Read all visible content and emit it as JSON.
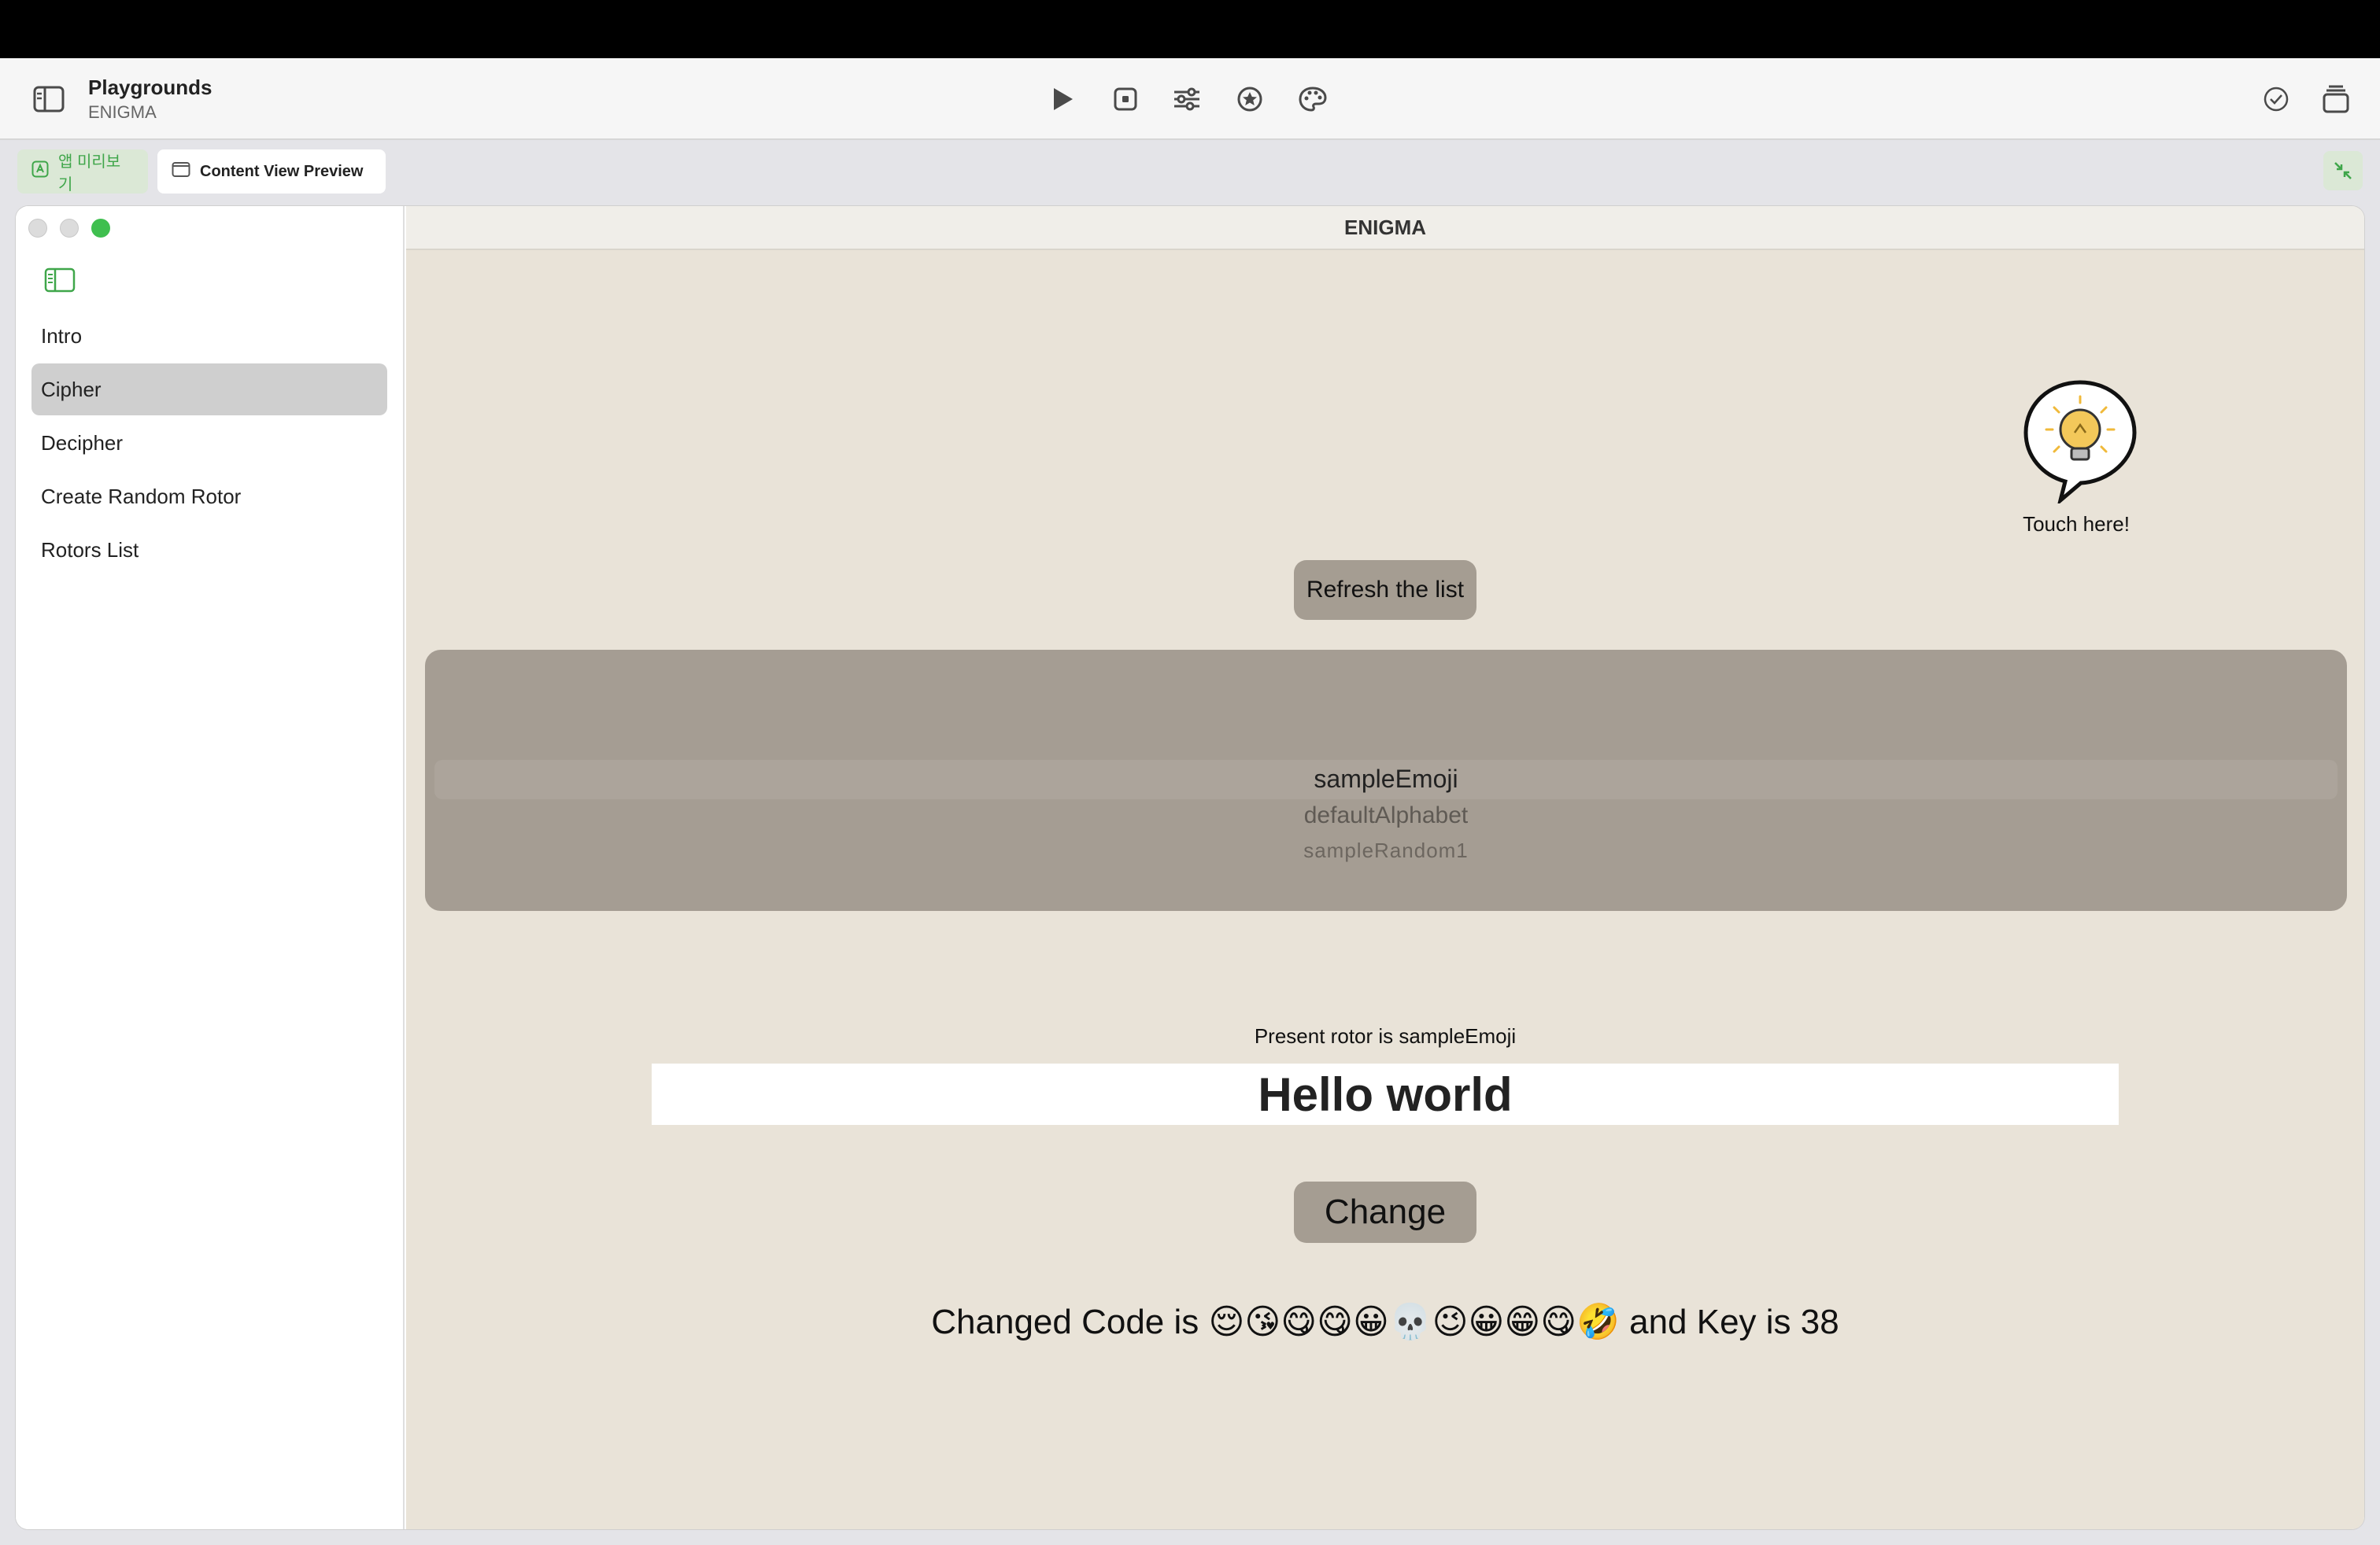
{
  "toolbar": {
    "title": "Playgrounds",
    "subtitle": "ENIGMA"
  },
  "tabs": {
    "app_preview_label": "앱 미리보기",
    "content_preview_label": "Content View Preview"
  },
  "sidebar": {
    "items": [
      {
        "label": "Intro"
      },
      {
        "label": "Cipher"
      },
      {
        "label": "Decipher"
      },
      {
        "label": "Create Random Rotor"
      },
      {
        "label": "Rotors List"
      }
    ],
    "selected": "Cipher"
  },
  "content": {
    "window_title": "ENIGMA",
    "hint_label": "Touch here!",
    "refresh_button": "Refresh the list",
    "picker": {
      "selected": "sampleEmoji",
      "options": [
        "sampleEmoji",
        "defaultAlphabet",
        "sampleRandom1"
      ]
    },
    "present_rotor": "Present rotor is sampleEmoji",
    "input_value": "Hello world",
    "change_button": "Change",
    "result": "Changed Code is 😌😘😋😋😀💀😉😀😁😋🤣 and Key is 38"
  },
  "colors": {
    "accent_green": "#3fa64a",
    "content_bg": "#e9e3d8",
    "button_bg": "#a59d92",
    "picker_bg": "#a59d93"
  }
}
